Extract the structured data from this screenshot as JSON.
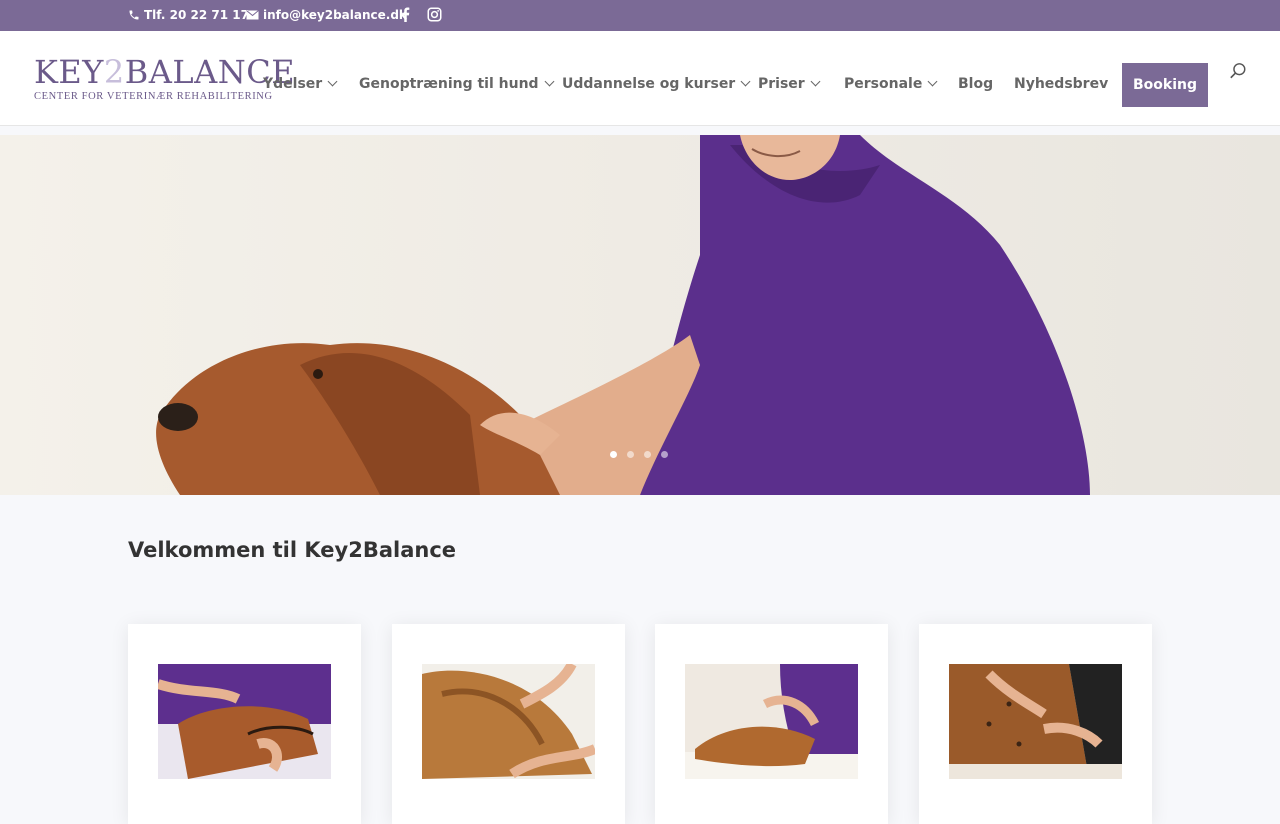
{
  "topbar": {
    "phone": "Tlf. 20 22 71 17",
    "email": "info@key2balance.dk",
    "social": [
      "facebook-icon",
      "instagram-icon"
    ],
    "color": "#7b6a96"
  },
  "logo": {
    "part1": "KEY",
    "part2": "2",
    "part3": "BALANCE",
    "tagline": "CENTER FOR VETERINÆR REHABILITERING"
  },
  "nav": {
    "items": [
      {
        "label": "Ydelser"
      },
      {
        "label": "Genoptræning til hund"
      },
      {
        "label": "Uddannelse og kurser"
      },
      {
        "label": "Priser"
      },
      {
        "label": "Personale"
      },
      {
        "label": "Blog"
      },
      {
        "label": "Nyhedsbrev"
      }
    ],
    "booking_label": "Booking"
  },
  "hero": {
    "slides": 4,
    "active_slide": 1
  },
  "main": {
    "welcome_title": "Velkommen til Key2Balance"
  }
}
